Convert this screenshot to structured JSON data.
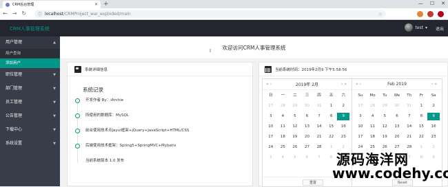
{
  "browser": {
    "tab_title": "CRM后台管理",
    "url_host": "localhost",
    "url_path": "/CRMProject_war_exploded/main",
    "colors": {
      "ext1": "#e8833a",
      "ext2": "#c0392b",
      "ext3": "#b3001b"
    }
  },
  "app": {
    "logo": "CRM人事管理系统",
    "username": "test",
    "logout": "退出"
  },
  "sidebar": {
    "items": [
      {
        "label": "用户管理",
        "subs": [
          "用户查询",
          "添加用户"
        ]
      },
      {
        "label": "职位管理"
      },
      {
        "label": "部门管理"
      },
      {
        "label": "员工管理"
      },
      {
        "label": "公告管理"
      },
      {
        "label": "下载中心"
      },
      {
        "label": "系统设置"
      }
    ]
  },
  "welcome": "欢迎访问CRM人事管理系统",
  "left_card": {
    "title": "系统详细信息",
    "section": "系统记录",
    "timeline": [
      "开发作者 By：iArchie",
      "所使用的数据库：MySQL",
      "前台使用技术点Jayui框架+jQuery+JavaScript+HTML/CSS",
      "后端使用技术框架：Spring5+SpringMVC+Mybatis",
      "当前系统版本 1.0 发布"
    ]
  },
  "right_card": {
    "title": "当前系统时间：2019年2月9 下午5:58:56",
    "cal_cn": {
      "header": "2019年  2月",
      "weekdays": [
        "日",
        "一",
        "二",
        "三",
        "四",
        "五",
        "六"
      ],
      "days": [
        [
          "27",
          "o"
        ],
        [
          "28",
          "o"
        ],
        [
          "29",
          "o"
        ],
        [
          "30",
          "o"
        ],
        [
          "31",
          "o"
        ],
        [
          "1",
          ""
        ],
        [
          "2",
          ""
        ],
        [
          "3",
          ""
        ],
        [
          "4",
          ""
        ],
        [
          "5",
          ""
        ],
        [
          "6",
          ""
        ],
        [
          "7",
          ""
        ],
        [
          "8",
          ""
        ],
        [
          "9",
          "sel"
        ],
        [
          "10",
          ""
        ],
        [
          "11",
          ""
        ],
        [
          "12",
          ""
        ],
        [
          "13",
          ""
        ],
        [
          "14",
          ""
        ],
        [
          "15",
          ""
        ],
        [
          "16",
          ""
        ],
        [
          "17",
          ""
        ],
        [
          "18",
          ""
        ],
        [
          "19",
          ""
        ],
        [
          "20",
          ""
        ],
        [
          "21",
          ""
        ],
        [
          "22",
          ""
        ],
        [
          "23",
          ""
        ],
        [
          "24",
          ""
        ],
        [
          "25",
          ""
        ],
        [
          "26",
          ""
        ],
        [
          "27",
          ""
        ],
        [
          "28",
          ""
        ],
        [
          "1",
          "o"
        ],
        [
          "2",
          "o"
        ],
        [
          "3",
          "o"
        ],
        [
          "4",
          "o"
        ],
        [
          "5",
          "o"
        ],
        [
          "6",
          "o"
        ],
        [
          "7",
          "o"
        ],
        [
          "8",
          "o"
        ],
        [
          "9",
          "o"
        ]
      ],
      "footer_btn": "重置"
    },
    "cal_en": {
      "header": "Feb  2019",
      "weekdays": [
        "Su",
        "Mo",
        "Tu",
        "We",
        "Th",
        "Fr",
        "Sa"
      ],
      "days": [
        [
          "27",
          "o"
        ],
        [
          "28",
          "o"
        ],
        [
          "29",
          "o"
        ],
        [
          "30",
          "o"
        ],
        [
          "31",
          "o"
        ],
        [
          "1",
          ""
        ],
        [
          "2",
          ""
        ],
        [
          "3",
          ""
        ],
        [
          "4",
          ""
        ],
        [
          "5",
          ""
        ],
        [
          "6",
          ""
        ],
        [
          "7",
          ""
        ],
        [
          "8",
          ""
        ],
        [
          "9",
          "sel"
        ],
        [
          "10",
          ""
        ],
        [
          "11",
          ""
        ],
        [
          "12",
          ""
        ],
        [
          "13",
          ""
        ],
        [
          "14",
          ""
        ],
        [
          "15",
          ""
        ],
        [
          "16",
          ""
        ],
        [
          "17",
          ""
        ],
        [
          "18",
          ""
        ],
        [
          "19",
          ""
        ],
        [
          "20",
          ""
        ],
        [
          "21",
          ""
        ],
        [
          "22",
          ""
        ],
        [
          "23",
          ""
        ],
        [
          "24",
          ""
        ],
        [
          "25",
          ""
        ],
        [
          "26",
          ""
        ],
        [
          "27",
          ""
        ],
        [
          "28",
          ""
        ],
        [
          "1",
          "o"
        ],
        [
          "2",
          "o"
        ],
        [
          "3",
          "o"
        ],
        [
          "4",
          "o"
        ],
        [
          "5",
          "o"
        ],
        [
          "6",
          "o"
        ],
        [
          "7",
          "o"
        ],
        [
          "8",
          "o"
        ],
        [
          "9",
          "o"
        ]
      ],
      "footer_btn": "Reset"
    }
  },
  "watermark": {
    "line1": "源码海洋网",
    "line2": "www.codehy.com"
  }
}
